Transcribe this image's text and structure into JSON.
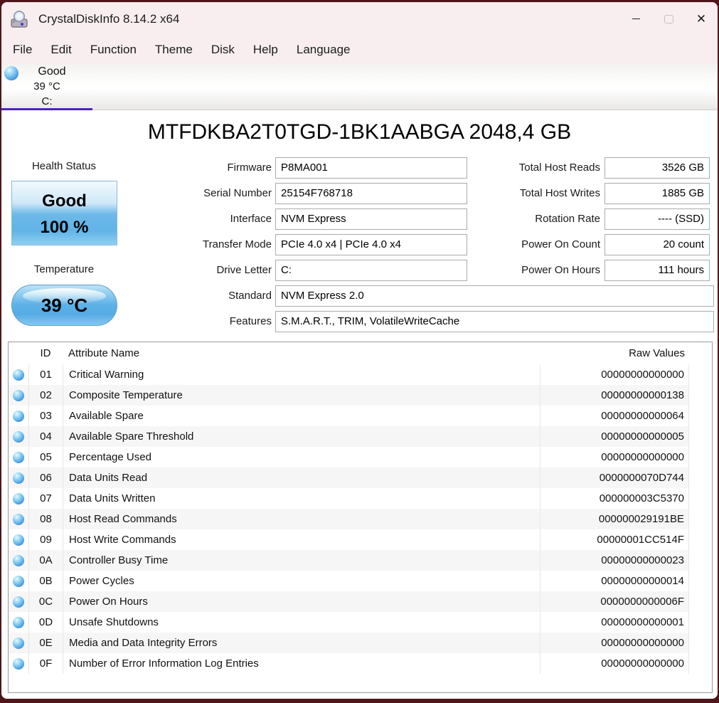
{
  "window": {
    "title": "CrystalDiskInfo 8.14.2 x64"
  },
  "icons": {
    "app_icon": "magnifier-over-disk",
    "minimize": "thin-dash",
    "maximize": "rounded-square-disabled",
    "close": "✕",
    "status_orb": "glossy-blue-sphere"
  },
  "menu": {
    "items": [
      "File",
      "Edit",
      "Function",
      "Theme",
      "Disk",
      "Help",
      "Language"
    ]
  },
  "drive_tab": {
    "status": "Good",
    "temperature": "39 °C",
    "letter": "C:",
    "selected": true
  },
  "drive": {
    "model": "MTFDKBA2T0TGD-1BK1AABGA 2048,4 GB",
    "health": {
      "label": "Health Status",
      "status": "Good",
      "percent": "100 %"
    },
    "temperature": {
      "label": "Temperature",
      "value": "39 °C"
    },
    "fields_left": [
      {
        "label": "Firmware",
        "value": "P8MA001"
      },
      {
        "label": "Serial Number",
        "value": "25154F768718"
      },
      {
        "label": "Interface",
        "value": "NVM Express"
      },
      {
        "label": "Transfer Mode",
        "value": "PCIe 4.0 x4 | PCIe 4.0 x4"
      },
      {
        "label": "Drive Letter",
        "value": "C:"
      }
    ],
    "fields_wide": [
      {
        "label": "Standard",
        "value": "NVM Express 2.0"
      },
      {
        "label": "Features",
        "value": "S.M.A.R.T., TRIM, VolatileWriteCache"
      }
    ],
    "fields_right": [
      {
        "label": "Total Host Reads",
        "value": "3526 GB"
      },
      {
        "label": "Total Host Writes",
        "value": "1885 GB"
      },
      {
        "label": "Rotation Rate",
        "value": "---- (SSD)"
      },
      {
        "label": "Power On Count",
        "value": "20 count"
      },
      {
        "label": "Power On Hours",
        "value": "111 hours"
      }
    ]
  },
  "smart_table": {
    "headers": {
      "id": "ID",
      "name": "Attribute Name",
      "raw": "Raw Values"
    },
    "rows": [
      {
        "id": "01",
        "name": "Critical Warning",
        "raw": "00000000000000",
        "status": "good"
      },
      {
        "id": "02",
        "name": "Composite Temperature",
        "raw": "00000000000138",
        "status": "good"
      },
      {
        "id": "03",
        "name": "Available Spare",
        "raw": "00000000000064",
        "status": "good"
      },
      {
        "id": "04",
        "name": "Available Spare Threshold",
        "raw": "00000000000005",
        "status": "good"
      },
      {
        "id": "05",
        "name": "Percentage Used",
        "raw": "00000000000000",
        "status": "good"
      },
      {
        "id": "06",
        "name": "Data Units Read",
        "raw": "0000000070D744",
        "status": "good"
      },
      {
        "id": "07",
        "name": "Data Units Written",
        "raw": "000000003C5370",
        "status": "good"
      },
      {
        "id": "08",
        "name": "Host Read Commands",
        "raw": "000000029191BE",
        "status": "good"
      },
      {
        "id": "09",
        "name": "Host Write Commands",
        "raw": "00000001CC514F",
        "status": "good"
      },
      {
        "id": "0A",
        "name": "Controller Busy Time",
        "raw": "00000000000023",
        "status": "good"
      },
      {
        "id": "0B",
        "name": "Power Cycles",
        "raw": "00000000000014",
        "status": "good"
      },
      {
        "id": "0C",
        "name": "Power On Hours",
        "raw": "0000000000006F",
        "status": "good"
      },
      {
        "id": "0D",
        "name": "Unsafe Shutdowns",
        "raw": "00000000000001",
        "status": "good"
      },
      {
        "id": "0E",
        "name": "Media and Data Integrity Errors",
        "raw": "00000000000000",
        "status": "good"
      },
      {
        "id": "0F",
        "name": "Number of Error Information Log Entries",
        "raw": "00000000000000",
        "status": "good"
      }
    ]
  },
  "colors": {
    "accent_underline": "#4a23c8",
    "titlebar_pink": "#f8eef0",
    "health_blue": "#61b3e7",
    "desktop_background": "#4e161a",
    "alt_row": "#f6f6f6"
  }
}
